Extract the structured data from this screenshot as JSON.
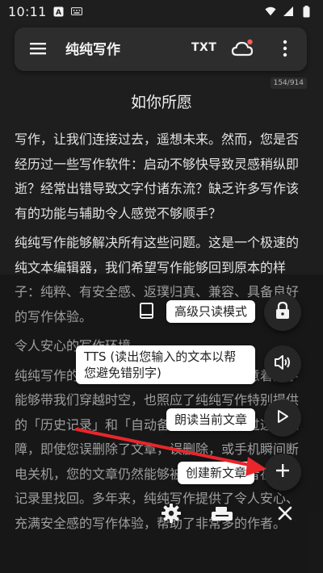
{
  "status_bar": {
    "time": "10:11"
  },
  "toolbar": {
    "title": "纯纯写作",
    "txt_label": "TXT"
  },
  "document": {
    "page_counter": "154/914",
    "title": "如你所愿",
    "paragraphs": [
      "写作，让我们连接过去，遥想未来。然而，您是否经历过一些写作软件：启动不够快导致灵感稍纵即逝？经常出错导致文字付诸东流？缺乏许多写作该有的功能与辅助令人感觉不够顺手？",
      "纯纯写作能够解决所有这些问题。这是一个极速的纯文本编辑器，我们希望写作能够回到原本的样子：纯粹、有安全感、返璞归真、兼容、具备良好的写作体验。",
      "令人安心的写作环境",
      "纯纯写作的图标是一个时光机的投影，寓意着文字能够带我们穿越时空，也照应了纯纯写作特别提供的「历史记录」和「自动备份」功能，通过这些保障，即使您误删除了文章，误删除，或手机瞬间断电关机，您的文章仍然能够被完整保存或者在历史记录里找回。多年来，纯纯写作提供了令人安心、充满安全感的写作体验，帮助了非常多的作者。"
    ]
  },
  "menu": {
    "readonly_label": "高级只读模式",
    "tts_label": "TTS (读出您输入的文本以帮您避免错别字)",
    "read_aloud_label": "朗读当前文章",
    "create_label": "创建新文章"
  },
  "colors": {
    "background": "#1e1e1e",
    "toolbar": "#2d2d2d",
    "fab": "#262626",
    "chip": "#ffffff",
    "arrow": "#e8262b",
    "notification_dot": "#ff5b5b"
  }
}
